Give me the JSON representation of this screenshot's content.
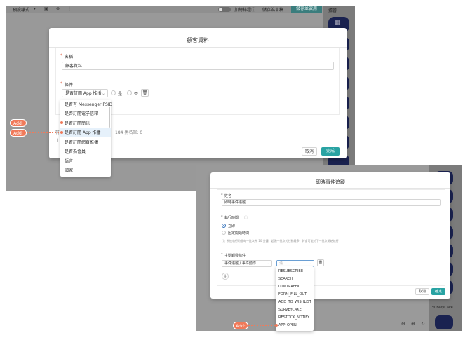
{
  "screen1": {
    "toolbar": {
      "preset_label": "預設樣式",
      "draft_toggle_label": "加總排程",
      "save_draft_label": "儲存為草稿",
      "save_enable_label": "儲存並啟用"
    },
    "side_panel_title": "據管",
    "modal": {
      "title": "顧客資料",
      "name_label": "名稱",
      "name_value": "顧客資料",
      "condition_label": "條件",
      "condition_select_value": "是否訂閱 App 推播",
      "radio_yes_label": "是",
      "radio_no_label": "否",
      "stats_text": "184  黑名單: 0",
      "partial_left_1": "符",
      "partial_left_2": "上",
      "cancel_label": "取消",
      "done_label": "完成"
    },
    "dropdown": {
      "items": [
        "是否有 Messenger PSID",
        "是否訂閱電子信箱",
        "是否訂閱簡訊",
        "是否訂閱 App 推播",
        "是否訂閱網頁推播",
        "是否為會員",
        "語言",
        "國家"
      ],
      "highlighted_index": 3
    },
    "annotations": [
      "Add:",
      "Add:"
    ]
  },
  "screen2": {
    "modal": {
      "title": "即時事件追蹤",
      "name_label": "姓名",
      "name_value": "即時事件追蹤",
      "exec_time_label": "執行時間",
      "option_immediate": "立即",
      "option_fixed": "固定開始時間",
      "note": "系統執行時間每一批次為 10 分鐘，超過一批次的任務最多，將會可能於下一批次開始執行",
      "trigger_label": "主動觸發條件",
      "trigger_select_value": "事件追蹤 / 事件動作",
      "trigger_select2_placeholder": "请",
      "cancel_label": "取消",
      "confirm_label": "確定"
    },
    "dropdown": {
      "items": [
        "RESUBSCRIBE",
        "SEARCH",
        "UTMTRAFFIC",
        "FORM_FILL_OUT",
        "ADD_TO_WISHLIST",
        "SURVEYCAKE",
        "RESTOCK_NOTIFY",
        "APP_OPEN"
      ]
    },
    "side_label": "SurveyCake",
    "annotation": "Add:"
  },
  "colors": {
    "accent_teal": "#29a3a3",
    "annotation_orange": "#f07a5a",
    "overlay_grey": "#999999",
    "node_navy": "#1a2250"
  },
  "icons": [
    "trash-icon",
    "chevron-down-icon",
    "info-icon",
    "plus-icon",
    "zoom-in-icon",
    "zoom-out-icon",
    "refresh-icon"
  ]
}
